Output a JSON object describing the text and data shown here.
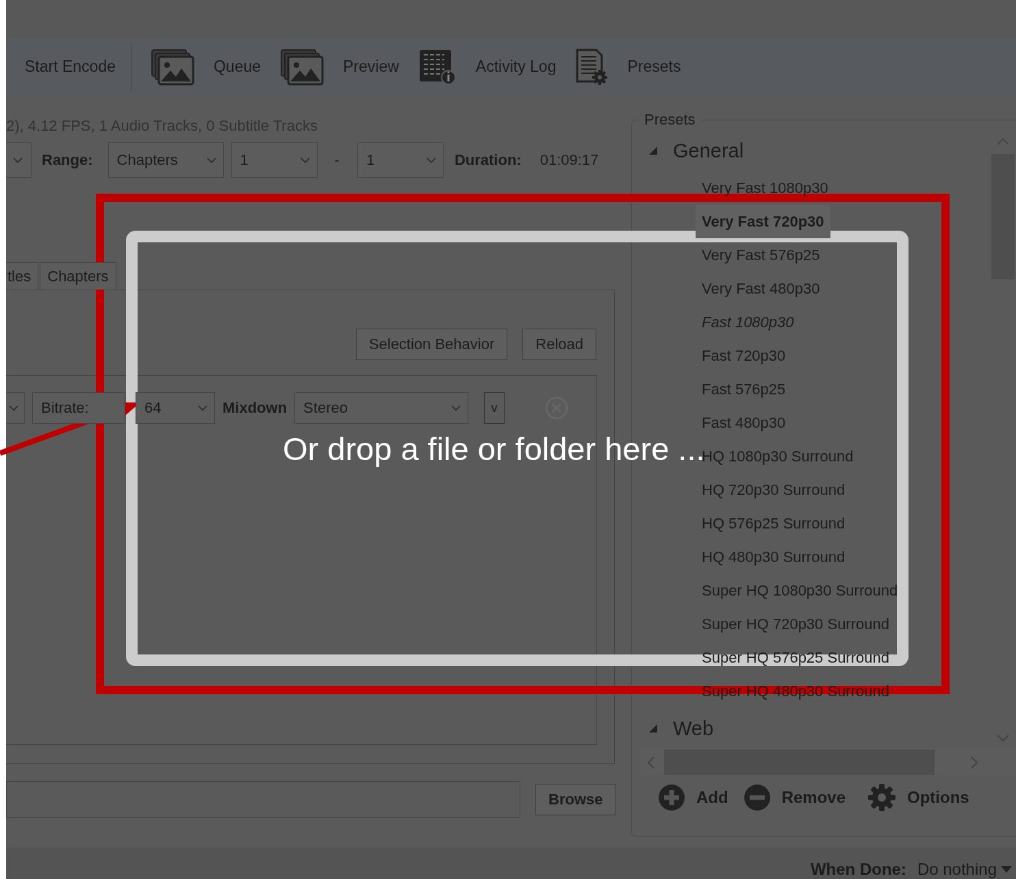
{
  "toolbar": {
    "items": [
      {
        "label": "Start Encode"
      },
      {
        "label": "Queue"
      },
      {
        "label": "Preview"
      },
      {
        "label": "Activity Log"
      },
      {
        "label": "Presets"
      }
    ]
  },
  "source_info": "2), 4.12 FPS, 1 Audio Tracks, 0 Subtitle Tracks",
  "range": {
    "label": "Range:",
    "mode": "Chapters",
    "start": "1",
    "separator": "-",
    "end": "1",
    "duration_label": "Duration:",
    "duration": "01:09:17"
  },
  "tabs": [
    {
      "label": "tles",
      "selected": false
    },
    {
      "label": "Chapters",
      "selected": false
    }
  ],
  "audio": {
    "buttons": [
      "Selection Behavior",
      "Reload"
    ],
    "track": {
      "bitrate_label": "Bitrate:",
      "bitrate": "64",
      "mixdown_label": "Mixdown",
      "mixdown": "Stereo",
      "more": "v"
    }
  },
  "destination": {
    "button": "Browse"
  },
  "presets": {
    "title": "Presets",
    "groups": [
      {
        "name": "General",
        "expanded": true,
        "children": [
          {
            "label": "Very Fast 1080p30",
            "selected": false,
            "default": false
          },
          {
            "label": "Very Fast 720p30",
            "selected": true,
            "default": false
          },
          {
            "label": "Very Fast 576p25",
            "selected": false,
            "default": false
          },
          {
            "label": "Very Fast 480p30",
            "selected": false,
            "default": false
          },
          {
            "label": "Fast 1080p30",
            "selected": false,
            "default": true
          },
          {
            "label": "Fast 720p30",
            "selected": false,
            "default": false
          },
          {
            "label": "Fast 576p25",
            "selected": false,
            "default": false
          },
          {
            "label": "Fast 480p30",
            "selected": false,
            "default": false
          },
          {
            "label": "HQ 1080p30 Surround",
            "selected": false,
            "default": false
          },
          {
            "label": "HQ 720p30 Surround",
            "selected": false,
            "default": false
          },
          {
            "label": "HQ 576p25 Surround",
            "selected": false,
            "default": false
          },
          {
            "label": "HQ 480p30 Surround",
            "selected": false,
            "default": false
          },
          {
            "label": "Super HQ 1080p30 Surround",
            "selected": false,
            "default": false
          },
          {
            "label": "Super HQ 720p30 Surround",
            "selected": false,
            "default": false
          },
          {
            "label": "Super HQ 576p25 Surround",
            "selected": false,
            "default": false
          },
          {
            "label": "Super HQ 480p30 Surround",
            "selected": false,
            "default": false
          }
        ]
      },
      {
        "name": "Web",
        "expanded": true
      }
    ],
    "actions": [
      {
        "label": "Add",
        "kind": "add"
      },
      {
        "label": "Remove",
        "kind": "remove"
      },
      {
        "label": "Options",
        "kind": "options"
      }
    ]
  },
  "status_bar": {
    "when_done_label": "When Done:",
    "when_done": "Do nothing"
  },
  "overlay": {
    "drop_text": "Or drop a file or folder here ..."
  }
}
